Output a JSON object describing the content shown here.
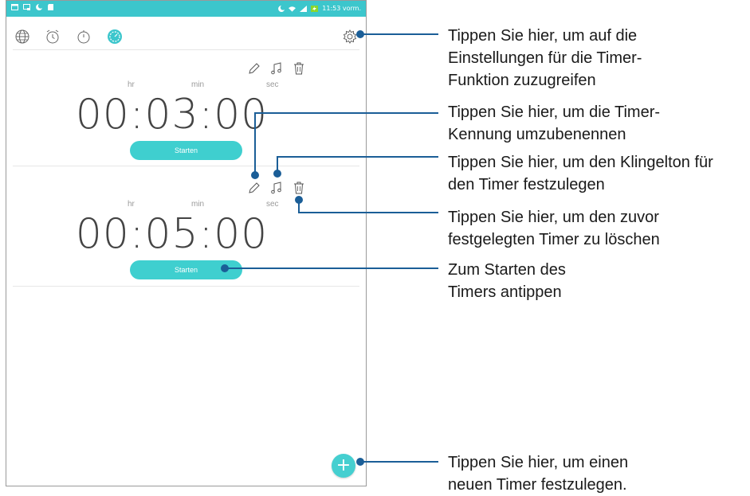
{
  "status_bar": {
    "time": "11:53 vorm."
  },
  "tabs": [
    {
      "name": "world-clock",
      "icon": "globe-icon"
    },
    {
      "name": "alarm",
      "icon": "alarm-clock-icon"
    },
    {
      "name": "stopwatch",
      "icon": "stopwatch-icon"
    },
    {
      "name": "timer",
      "icon": "timer-icon",
      "active": true
    }
  ],
  "timers": [
    {
      "hr_label": "hr",
      "min_label": "min",
      "sec_label": "sec",
      "display": "00:03:00",
      "start_label": "Starten"
    },
    {
      "hr_label": "hr",
      "min_label": "min",
      "sec_label": "sec",
      "display": "00:05:00",
      "start_label": "Starten"
    }
  ],
  "fab": {
    "icon": "plus-icon"
  },
  "callouts": [
    "Tippen Sie hier, um auf die\nEinstellungen für die Timer-\nFunktion zuzugreifen",
    "Tippen Sie hier, um die Timer-\nKennung umzubenennen",
    "Tippen Sie hier, um den Klingelton für\nden Timer festzulegen",
    "Tippen Sie hier, um den zuvor\nfestgelegten Timer zu löschen",
    "Zum Starten des\nTimers antippen",
    "Tippen Sie hier, um einen\nneuen Timer festzulegen."
  ],
  "colors": {
    "accent": "#3fcfcf",
    "callout_line": "#1b5e97"
  }
}
